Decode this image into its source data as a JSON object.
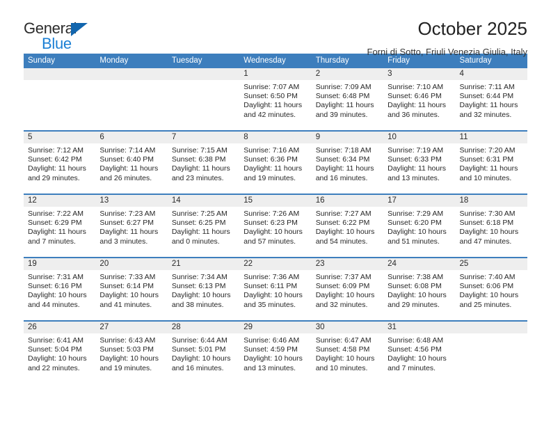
{
  "brand": {
    "name_top": "General",
    "name_bottom": "Blue",
    "triangle_color": "#1266ae",
    "blue_color": "#1b7fd4"
  },
  "header": {
    "month_title": "October 2025",
    "location": "Forni di Sotto, Friuli Venezia Giulia, Italy"
  },
  "theme": {
    "header_blue": "#3d7ebd",
    "day_band_gray": "#eeeeee"
  },
  "weekdays": [
    "Sunday",
    "Monday",
    "Tuesday",
    "Wednesday",
    "Thursday",
    "Friday",
    "Saturday"
  ],
  "weeks": [
    [
      {
        "day": "",
        "empty": true,
        "sunrise": "",
        "sunset": "",
        "daylight_line1": "",
        "daylight_line2": ""
      },
      {
        "day": "",
        "empty": true,
        "sunrise": "",
        "sunset": "",
        "daylight_line1": "",
        "daylight_line2": ""
      },
      {
        "day": "",
        "empty": true,
        "sunrise": "",
        "sunset": "",
        "daylight_line1": "",
        "daylight_line2": ""
      },
      {
        "day": "1",
        "sunrise": "Sunrise: 7:07 AM",
        "sunset": "Sunset: 6:50 PM",
        "daylight_line1": "Daylight: 11 hours",
        "daylight_line2": "and 42 minutes."
      },
      {
        "day": "2",
        "sunrise": "Sunrise: 7:09 AM",
        "sunset": "Sunset: 6:48 PM",
        "daylight_line1": "Daylight: 11 hours",
        "daylight_line2": "and 39 minutes."
      },
      {
        "day": "3",
        "sunrise": "Sunrise: 7:10 AM",
        "sunset": "Sunset: 6:46 PM",
        "daylight_line1": "Daylight: 11 hours",
        "daylight_line2": "and 36 minutes."
      },
      {
        "day": "4",
        "sunrise": "Sunrise: 7:11 AM",
        "sunset": "Sunset: 6:44 PM",
        "daylight_line1": "Daylight: 11 hours",
        "daylight_line2": "and 32 minutes."
      }
    ],
    [
      {
        "day": "5",
        "sunrise": "Sunrise: 7:12 AM",
        "sunset": "Sunset: 6:42 PM",
        "daylight_line1": "Daylight: 11 hours",
        "daylight_line2": "and 29 minutes."
      },
      {
        "day": "6",
        "sunrise": "Sunrise: 7:14 AM",
        "sunset": "Sunset: 6:40 PM",
        "daylight_line1": "Daylight: 11 hours",
        "daylight_line2": "and 26 minutes."
      },
      {
        "day": "7",
        "sunrise": "Sunrise: 7:15 AM",
        "sunset": "Sunset: 6:38 PM",
        "daylight_line1": "Daylight: 11 hours",
        "daylight_line2": "and 23 minutes."
      },
      {
        "day": "8",
        "sunrise": "Sunrise: 7:16 AM",
        "sunset": "Sunset: 6:36 PM",
        "daylight_line1": "Daylight: 11 hours",
        "daylight_line2": "and 19 minutes."
      },
      {
        "day": "9",
        "sunrise": "Sunrise: 7:18 AM",
        "sunset": "Sunset: 6:34 PM",
        "daylight_line1": "Daylight: 11 hours",
        "daylight_line2": "and 16 minutes."
      },
      {
        "day": "10",
        "sunrise": "Sunrise: 7:19 AM",
        "sunset": "Sunset: 6:33 PM",
        "daylight_line1": "Daylight: 11 hours",
        "daylight_line2": "and 13 minutes."
      },
      {
        "day": "11",
        "sunrise": "Sunrise: 7:20 AM",
        "sunset": "Sunset: 6:31 PM",
        "daylight_line1": "Daylight: 11 hours",
        "daylight_line2": "and 10 minutes."
      }
    ],
    [
      {
        "day": "12",
        "sunrise": "Sunrise: 7:22 AM",
        "sunset": "Sunset: 6:29 PM",
        "daylight_line1": "Daylight: 11 hours",
        "daylight_line2": "and 7 minutes."
      },
      {
        "day": "13",
        "sunrise": "Sunrise: 7:23 AM",
        "sunset": "Sunset: 6:27 PM",
        "daylight_line1": "Daylight: 11 hours",
        "daylight_line2": "and 3 minutes."
      },
      {
        "day": "14",
        "sunrise": "Sunrise: 7:25 AM",
        "sunset": "Sunset: 6:25 PM",
        "daylight_line1": "Daylight: 11 hours",
        "daylight_line2": "and 0 minutes."
      },
      {
        "day": "15",
        "sunrise": "Sunrise: 7:26 AM",
        "sunset": "Sunset: 6:23 PM",
        "daylight_line1": "Daylight: 10 hours",
        "daylight_line2": "and 57 minutes."
      },
      {
        "day": "16",
        "sunrise": "Sunrise: 7:27 AM",
        "sunset": "Sunset: 6:22 PM",
        "daylight_line1": "Daylight: 10 hours",
        "daylight_line2": "and 54 minutes."
      },
      {
        "day": "17",
        "sunrise": "Sunrise: 7:29 AM",
        "sunset": "Sunset: 6:20 PM",
        "daylight_line1": "Daylight: 10 hours",
        "daylight_line2": "and 51 minutes."
      },
      {
        "day": "18",
        "sunrise": "Sunrise: 7:30 AM",
        "sunset": "Sunset: 6:18 PM",
        "daylight_line1": "Daylight: 10 hours",
        "daylight_line2": "and 47 minutes."
      }
    ],
    [
      {
        "day": "19",
        "sunrise": "Sunrise: 7:31 AM",
        "sunset": "Sunset: 6:16 PM",
        "daylight_line1": "Daylight: 10 hours",
        "daylight_line2": "and 44 minutes."
      },
      {
        "day": "20",
        "sunrise": "Sunrise: 7:33 AM",
        "sunset": "Sunset: 6:14 PM",
        "daylight_line1": "Daylight: 10 hours",
        "daylight_line2": "and 41 minutes."
      },
      {
        "day": "21",
        "sunrise": "Sunrise: 7:34 AM",
        "sunset": "Sunset: 6:13 PM",
        "daylight_line1": "Daylight: 10 hours",
        "daylight_line2": "and 38 minutes."
      },
      {
        "day": "22",
        "sunrise": "Sunrise: 7:36 AM",
        "sunset": "Sunset: 6:11 PM",
        "daylight_line1": "Daylight: 10 hours",
        "daylight_line2": "and 35 minutes."
      },
      {
        "day": "23",
        "sunrise": "Sunrise: 7:37 AM",
        "sunset": "Sunset: 6:09 PM",
        "daylight_line1": "Daylight: 10 hours",
        "daylight_line2": "and 32 minutes."
      },
      {
        "day": "24",
        "sunrise": "Sunrise: 7:38 AM",
        "sunset": "Sunset: 6:08 PM",
        "daylight_line1": "Daylight: 10 hours",
        "daylight_line2": "and 29 minutes."
      },
      {
        "day": "25",
        "sunrise": "Sunrise: 7:40 AM",
        "sunset": "Sunset: 6:06 PM",
        "daylight_line1": "Daylight: 10 hours",
        "daylight_line2": "and 25 minutes."
      }
    ],
    [
      {
        "day": "26",
        "sunrise": "Sunrise: 6:41 AM",
        "sunset": "Sunset: 5:04 PM",
        "daylight_line1": "Daylight: 10 hours",
        "daylight_line2": "and 22 minutes."
      },
      {
        "day": "27",
        "sunrise": "Sunrise: 6:43 AM",
        "sunset": "Sunset: 5:03 PM",
        "daylight_line1": "Daylight: 10 hours",
        "daylight_line2": "and 19 minutes."
      },
      {
        "day": "28",
        "sunrise": "Sunrise: 6:44 AM",
        "sunset": "Sunset: 5:01 PM",
        "daylight_line1": "Daylight: 10 hours",
        "daylight_line2": "and 16 minutes."
      },
      {
        "day": "29",
        "sunrise": "Sunrise: 6:46 AM",
        "sunset": "Sunset: 4:59 PM",
        "daylight_line1": "Daylight: 10 hours",
        "daylight_line2": "and 13 minutes."
      },
      {
        "day": "30",
        "sunrise": "Sunrise: 6:47 AM",
        "sunset": "Sunset: 4:58 PM",
        "daylight_line1": "Daylight: 10 hours",
        "daylight_line2": "and 10 minutes."
      },
      {
        "day": "31",
        "sunrise": "Sunrise: 6:48 AM",
        "sunset": "Sunset: 4:56 PM",
        "daylight_line1": "Daylight: 10 hours",
        "daylight_line2": "and 7 minutes."
      },
      {
        "day": "",
        "empty": true,
        "sunrise": "",
        "sunset": "",
        "daylight_line1": "",
        "daylight_line2": ""
      }
    ]
  ]
}
